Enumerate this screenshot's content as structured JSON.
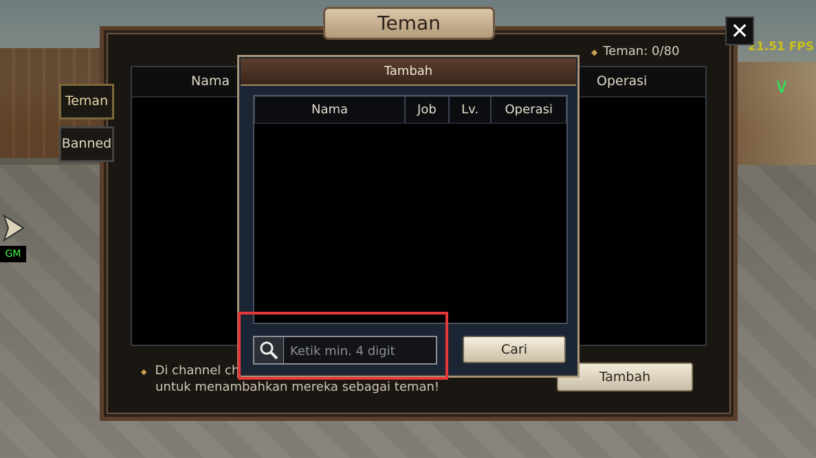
{
  "overlay": {
    "fps": "21.51 FPS",
    "gm_label": "GM"
  },
  "window": {
    "title": "Teman",
    "friend_count": "Teman: 0/80"
  },
  "tabs": [
    "Teman",
    "Banned"
  ],
  "main_table": {
    "col_name": "Nama",
    "col_operation": "Operasi"
  },
  "note": "Di channel cha",
  "note_line2": "untuk menambahkan mereka sebagai teman!",
  "main_button": "Tambah",
  "dialog": {
    "title": "Tambah",
    "columns": [
      "Nama",
      "Job",
      "Lv.",
      "Operasi"
    ],
    "search_placeholder": "Ketik min. 4 digit",
    "search_button": "Cari"
  }
}
